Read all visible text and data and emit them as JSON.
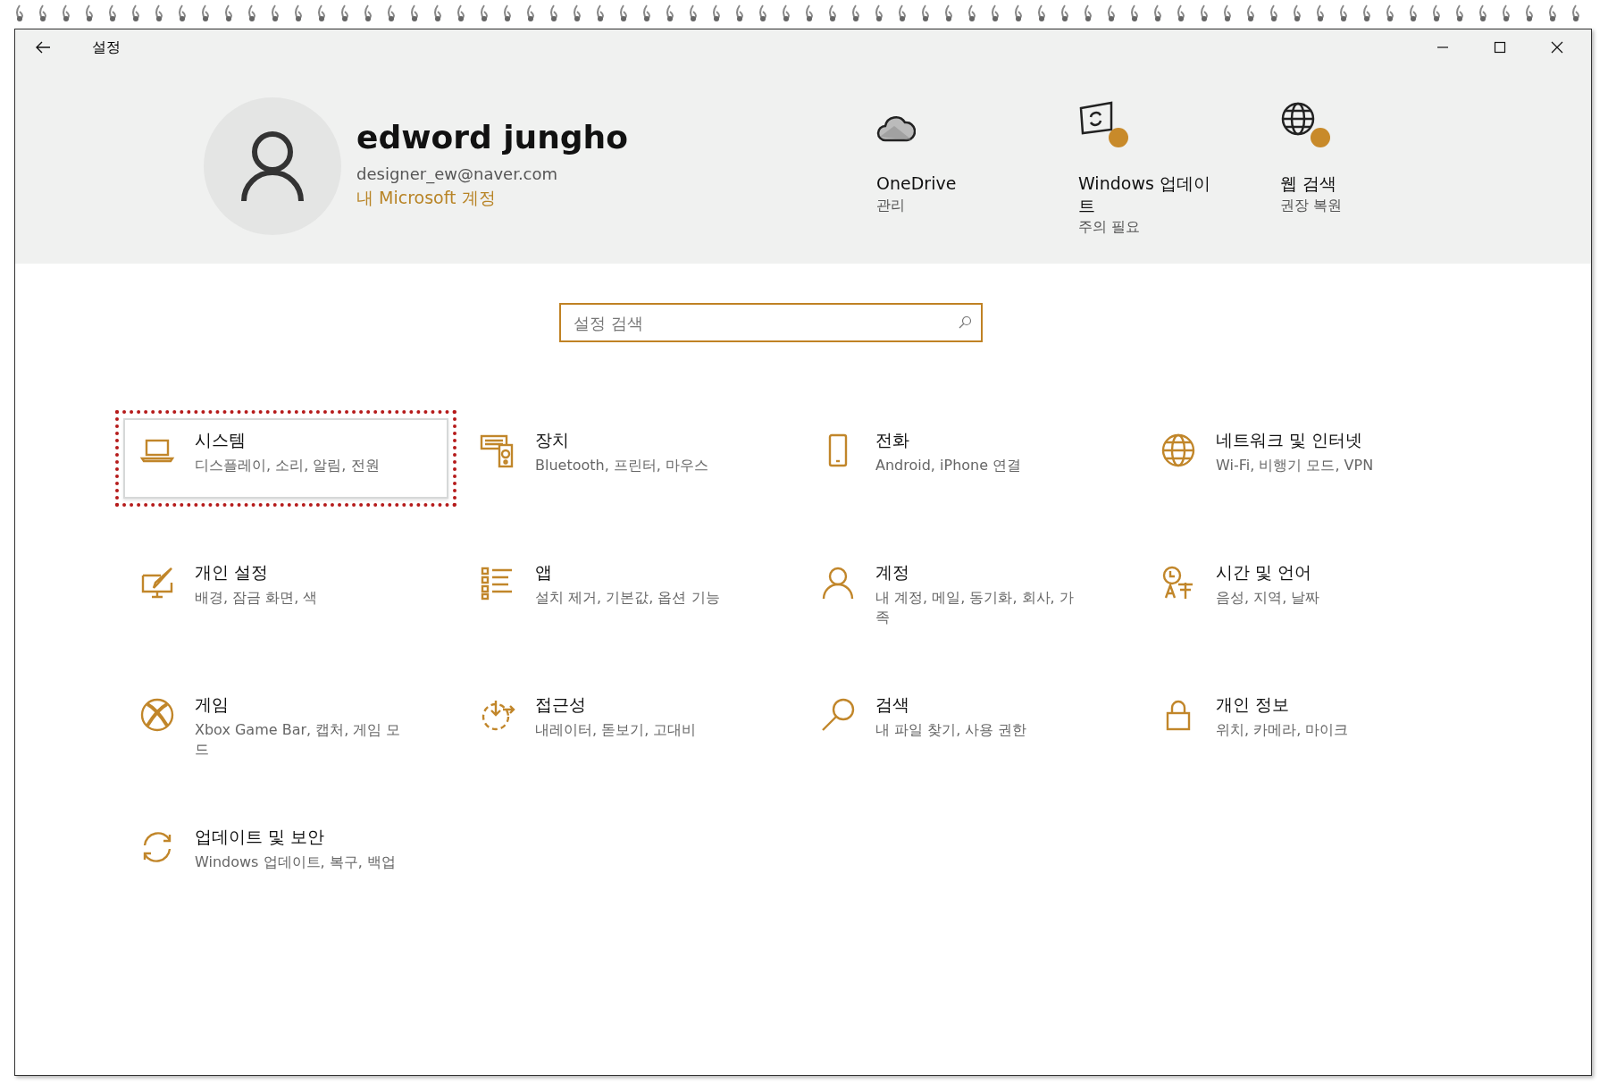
{
  "window": {
    "title": "설정"
  },
  "profile": {
    "name": "edword jungho",
    "email": "designer_ew@naver.com",
    "account_link": "내 Microsoft 계정"
  },
  "quick_links": [
    {
      "title": "OneDrive",
      "subtitle": "관리",
      "alert": false
    },
    {
      "title": "Windows 업데이트",
      "subtitle": "주의 필요",
      "alert": true
    },
    {
      "title": "웹 검색",
      "subtitle": "권장 복원",
      "alert": true
    }
  ],
  "search": {
    "placeholder": "설정 검색"
  },
  "categories": [
    {
      "title": "시스템",
      "subtitle": "디스플레이, 소리, 알림, 전원",
      "selected": true
    },
    {
      "title": "장치",
      "subtitle": "Bluetooth, 프린터, 마우스",
      "selected": false
    },
    {
      "title": "전화",
      "subtitle": "Android, iPhone 연결",
      "selected": false
    },
    {
      "title": "네트워크 및 인터넷",
      "subtitle": "Wi-Fi, 비행기 모드, VPN",
      "selected": false
    },
    {
      "title": "개인 설정",
      "subtitle": "배경, 잠금 화면, 색",
      "selected": false
    },
    {
      "title": "앱",
      "subtitle": "설치 제거, 기본값, 옵션 기능",
      "selected": false
    },
    {
      "title": "계정",
      "subtitle": "내 계정, 메일, 동기화, 회사, 가족",
      "selected": false
    },
    {
      "title": "시간 및 언어",
      "subtitle": "음성, 지역, 날짜",
      "selected": false
    },
    {
      "title": "게임",
      "subtitle": "Xbox Game Bar, 캡처, 게임 모드",
      "selected": false
    },
    {
      "title": "접근성",
      "subtitle": "내레이터, 돋보기, 고대비",
      "selected": false
    },
    {
      "title": "검색",
      "subtitle": "내 파일 찾기, 사용 권한",
      "selected": false
    },
    {
      "title": "개인 정보",
      "subtitle": "위치, 카메라, 마이크",
      "selected": false
    },
    {
      "title": "업데이트 및 보안",
      "subtitle": "Windows 업데이트, 복구, 백업",
      "selected": false
    }
  ]
}
